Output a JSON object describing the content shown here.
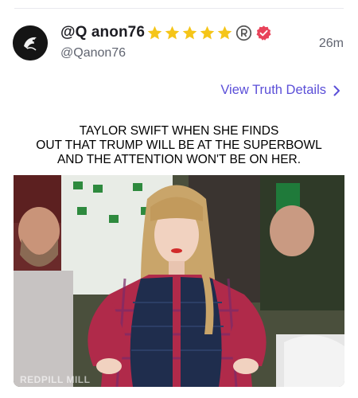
{
  "post": {
    "display_name": "@Q anon76",
    "handle": "@Qanon76",
    "time_ago": "26m",
    "star_count": 5,
    "badges": [
      "star-icon",
      "registered-icon",
      "verified-badge-icon"
    ],
    "view_details_label": "View Truth Details"
  },
  "meme": {
    "caption_lines": [
      "TAYLOR SWIFT WHEN SHE FINDS",
      "OUT THAT TRUMP WILL BE AT THE SUPERBOWL",
      "AND THE ATTENTION WON'T BE ON HER."
    ],
    "watermark": "REDPILL MILL"
  },
  "colors": {
    "link": "#5b4fd8",
    "star": "#f5c518",
    "verified": "#e8435a",
    "text": "#1d1d23",
    "muted": "#606470"
  }
}
